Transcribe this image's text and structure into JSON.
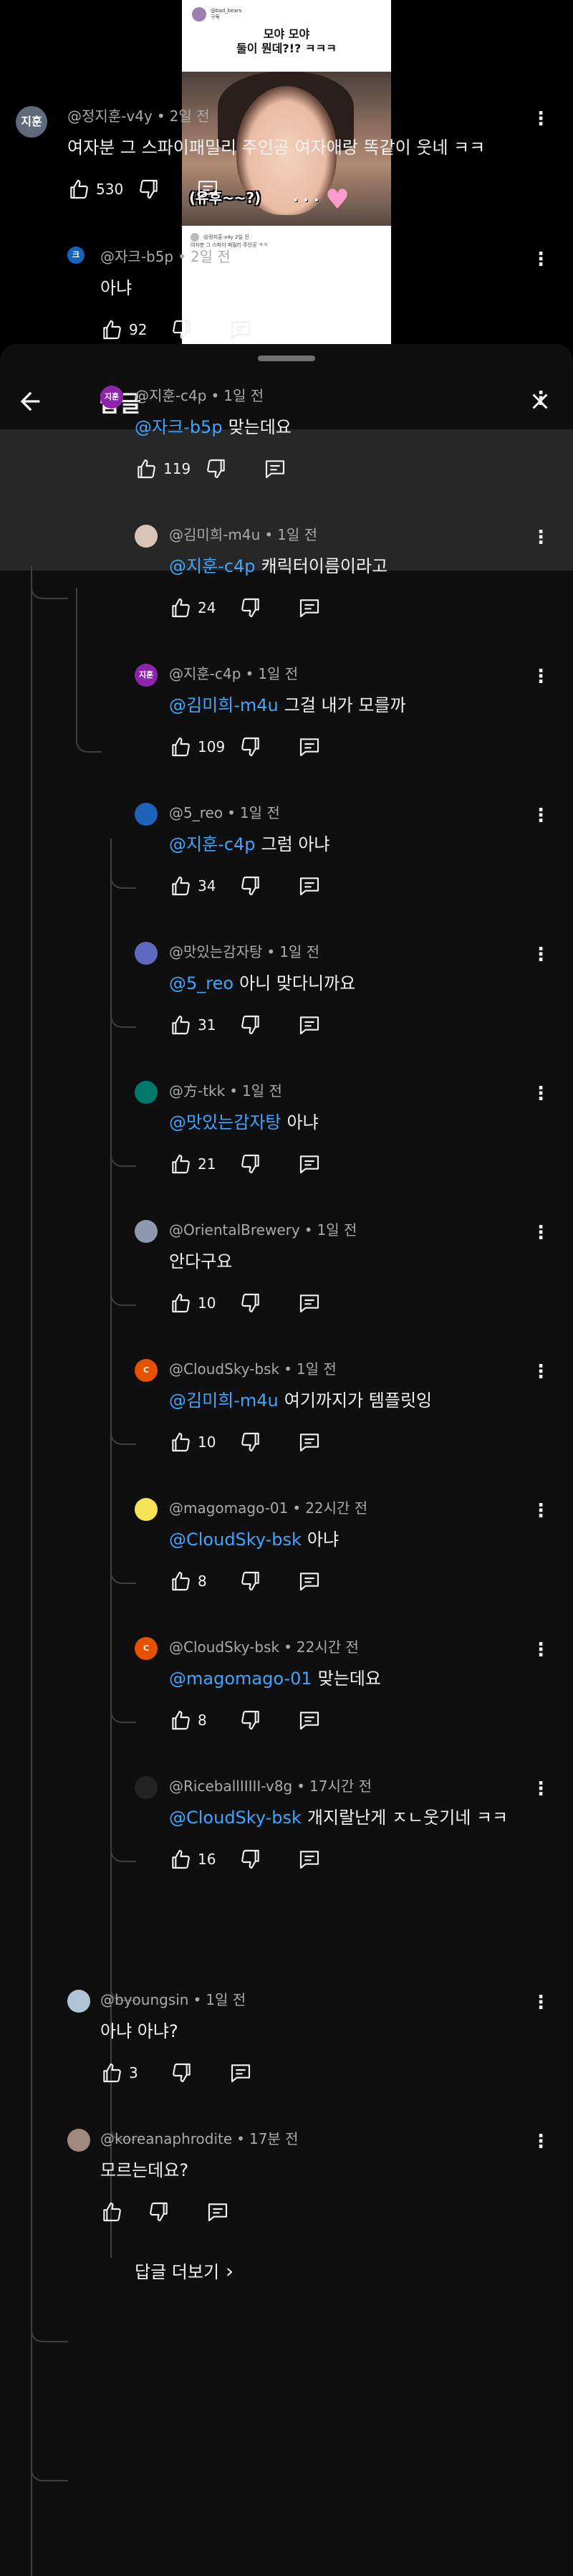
{
  "short": {
    "channel_name": "@bad_bears",
    "channel_sub": "구독",
    "title_line1": "모야 모야",
    "title_line2": "둘이 뭔데?!? ㅋㅋㅋ",
    "caption": "(유후~~?)",
    "caption_dots": ". . .",
    "footer_user": "@정지훈-v4y 2일 전",
    "footer_text": "여자분 그 스파이 패밀리 주인공 ㅋㅋ"
  },
  "panel": {
    "title": "답글"
  },
  "comments": [
    {
      "avatar_text": "지훈",
      "avatar_color": "#5f6b7a",
      "author": "@정지훈-v4y",
      "time": "2일 전",
      "mention": "",
      "text": "여자분 그 스파이패밀리 주인공 여자애랑 똑같이 웃네 ㅋㅋ",
      "likes": "530"
    },
    {
      "avatar_text": "크",
      "avatar_color": "#1565c0",
      "author": "@자크-b5p",
      "time": "2일 전",
      "mention": "",
      "text": "아냐",
      "likes": "92"
    },
    {
      "avatar_text": "지훈",
      "avatar_color": "#8e24aa",
      "author": "@지훈-c4p",
      "time": "1일 전",
      "mention": "@자크-b5p",
      "text": "맞는데요",
      "likes": "119"
    },
    {
      "avatar_text": "",
      "avatar_color": "#d7c6b8",
      "author": "@김미희-m4u",
      "time": "1일 전",
      "mention": "@지훈-c4p",
      "text": "캐릭터이름이라고",
      "likes": "24"
    },
    {
      "avatar_text": "지훈",
      "avatar_color": "#8e24aa",
      "author": "@지훈-c4p",
      "time": "1일 전",
      "mention": "@김미희-m4u",
      "text": "그걸 내가 모를까",
      "likes": "109"
    },
    {
      "avatar_text": "",
      "avatar_color": "#1e63b8",
      "author": "@5_reo",
      "time": "1일 전",
      "mention": "@지훈-c4p",
      "text": "그럼 아냐",
      "likes": "34"
    },
    {
      "avatar_text": "",
      "avatar_color": "#5c6bc0",
      "author": "@맛있는감자탕",
      "time": "1일 전",
      "mention": "@5_reo",
      "text": "아니 맞다니까요",
      "likes": "31"
    },
    {
      "avatar_text": "",
      "avatar_color": "#00796b",
      "author": "@方-tkk",
      "time": "1일 전",
      "mention": "@맛있는감자탕",
      "text": "아냐",
      "likes": "21"
    },
    {
      "avatar_text": "",
      "avatar_color": "#8d99ae",
      "author": "@OrientalBrewery",
      "time": "1일 전",
      "mention": "",
      "text": "안다구요",
      "likes": "10"
    },
    {
      "avatar_text": "C",
      "avatar_color": "#e65100",
      "author": "@CloudSky-bsk",
      "time": "1일 전",
      "mention": "@김미희-m4u",
      "text": "여기까지가 템플릿잉",
      "likes": "10"
    },
    {
      "avatar_text": "",
      "avatar_color": "#f5e35a",
      "author": "@magomago-01",
      "time": "22시간 전",
      "mention": "@CloudSky-bsk",
      "text": "아냐",
      "likes": "8"
    },
    {
      "avatar_text": "C",
      "avatar_color": "#e65100",
      "author": "@CloudSky-bsk",
      "time": "22시간 전",
      "mention": "@magomago-01",
      "text": "맞는데요",
      "likes": "8"
    },
    {
      "avatar_text": "",
      "avatar_color": "#222222",
      "author": "@RiceballIIIII-v8g",
      "time": "17시간 전",
      "mention": "@CloudSky-bsk",
      "text": "개지랄난게 ㅈㄴ웃기네 ㅋㅋ",
      "likes": "16"
    },
    {
      "avatar_text": "",
      "avatar_color": "#b0c4d8",
      "author": "@byoungsin",
      "time": "1일 전",
      "mention": "",
      "text": "아냐 아냐?",
      "likes": "3"
    },
    {
      "avatar_text": "",
      "avatar_color": "#a1887f",
      "author": "@koreanaphrodite",
      "time": "17분 전",
      "mention": "",
      "text": "모르는데요?",
      "likes": ""
    }
  ],
  "more_replies": "답글 더보기",
  "icons": {
    "back": "arrow-left-icon",
    "close": "close-icon",
    "like": "thumb-up-icon",
    "dislike": "thumb-down-icon",
    "reply": "reply-icon",
    "more": "more-vertical-icon"
  },
  "colors": {
    "background": "#0f0f0f",
    "highlight": "#272727",
    "mention": "#3ea6ff",
    "meta": "#aaaaaa"
  }
}
